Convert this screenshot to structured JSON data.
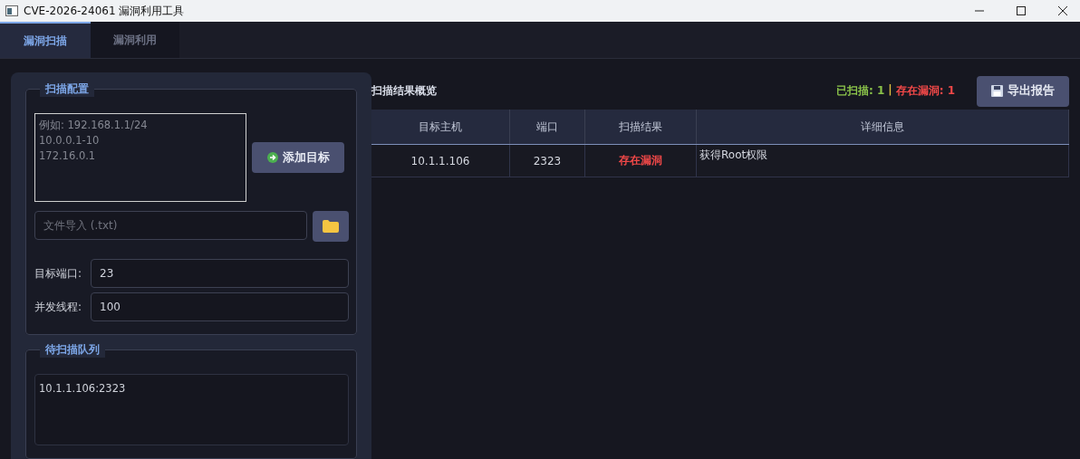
{
  "window": {
    "title": "CVE-2026-24061 漏洞利用工具"
  },
  "tabs": [
    {
      "label": "漏洞扫描",
      "selected": true
    },
    {
      "label": "漏洞利用",
      "selected": false
    }
  ],
  "config": {
    "title": "扫描配置",
    "targets_placeholder": "例如: 192.168.1.1/24\n10.0.0.1-10\n172.16.0.1",
    "add_button": "添加目标",
    "file_placeholder": "文件导入 (.txt)",
    "fields": [
      {
        "label": "目标端口:",
        "value": "23"
      },
      {
        "label": "并发线程:",
        "value": "100"
      }
    ]
  },
  "queue": {
    "title": "待扫描队列",
    "items": [
      "10.1.1.106:2323"
    ]
  },
  "results": {
    "title": "扫描结果概览",
    "scanned": "已扫描: 1",
    "separator": "|",
    "vulnerable": "存在漏洞: 1",
    "export_button": "导出报告",
    "columns": [
      "目标主机",
      "端口",
      "扫描结果",
      "详细信息"
    ],
    "rows": [
      {
        "host": "10.1.1.106",
        "port": "2323",
        "result": "存在漏洞",
        "kind": "vulnerable",
        "detail": "获得Root权限"
      }
    ]
  }
}
